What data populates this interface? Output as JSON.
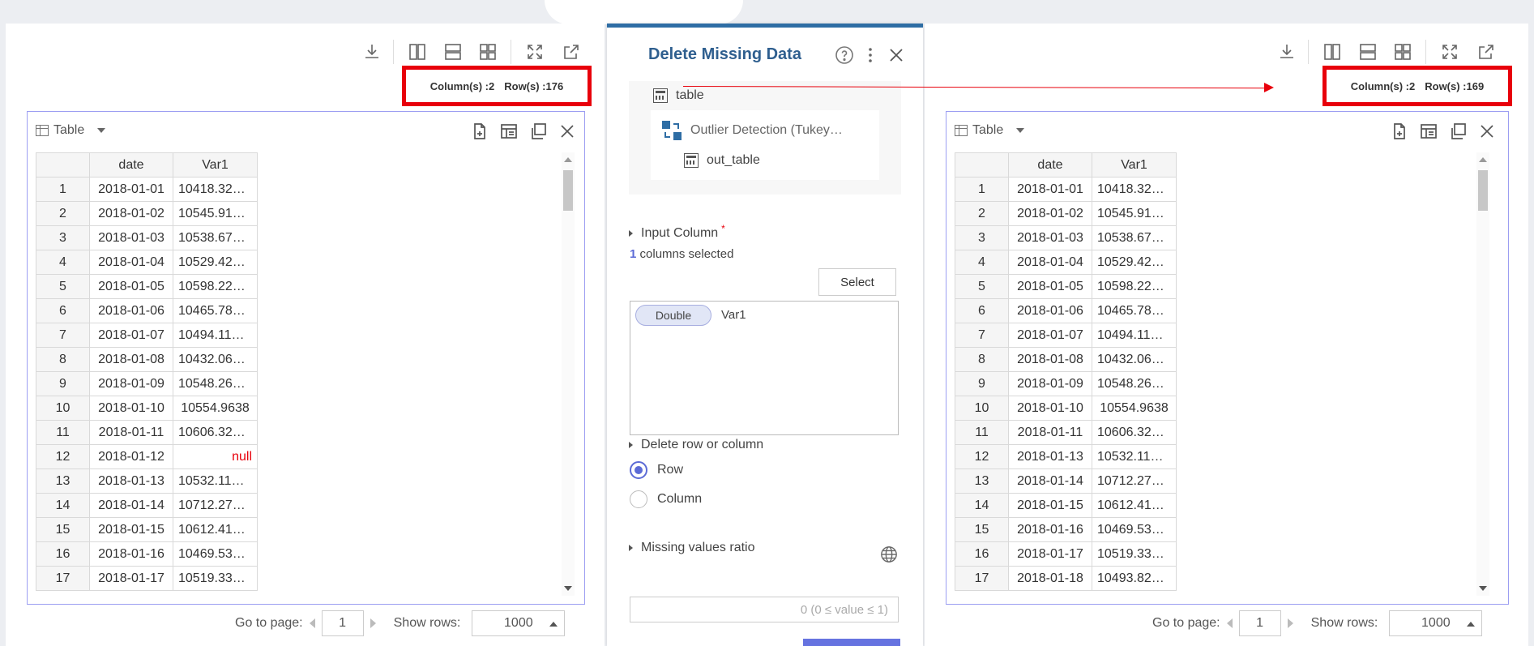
{
  "colors": {
    "accent": "#2e6da4",
    "highlight": "#e8000b",
    "radio": "#5c6bd6"
  },
  "left_panel": {
    "stats": {
      "columns": "Column(s) :2",
      "rows": "Row(s) :176"
    },
    "table_title": "Table",
    "columns": [
      "date",
      "Var1"
    ],
    "rows": [
      [
        "1",
        "2018-01-01",
        "10418.32..."
      ],
      [
        "2",
        "2018-01-02",
        "10545.91..."
      ],
      [
        "3",
        "2018-01-03",
        "10538.67..."
      ],
      [
        "4",
        "2018-01-04",
        "10529.42..."
      ],
      [
        "5",
        "2018-01-05",
        "10598.22..."
      ],
      [
        "6",
        "2018-01-06",
        "10465.78..."
      ],
      [
        "7",
        "2018-01-07",
        "10494.11..."
      ],
      [
        "8",
        "2018-01-08",
        "10432.06..."
      ],
      [
        "9",
        "2018-01-09",
        "10548.26..."
      ],
      [
        "10",
        "2018-01-10",
        "10554.9638"
      ],
      [
        "11",
        "2018-01-11",
        "10606.32..."
      ],
      [
        "12",
        "2018-01-12",
        "null"
      ],
      [
        "13",
        "2018-01-13",
        "10532.11..."
      ],
      [
        "14",
        "2018-01-14",
        "10712.27..."
      ],
      [
        "15",
        "2018-01-15",
        "10612.41..."
      ],
      [
        "16",
        "2018-01-16",
        "10469.53..."
      ],
      [
        "17",
        "2018-01-17",
        "10519.33..."
      ]
    ],
    "pager": {
      "goto_label": "Go to page:",
      "page": "1",
      "show_rows_label": "Show rows:",
      "show_rows": "1000"
    }
  },
  "right_panel": {
    "stats": {
      "columns": "Column(s) :2",
      "rows": "Row(s) :169"
    },
    "table_title": "Table",
    "columns": [
      "date",
      "Var1"
    ],
    "rows": [
      [
        "1",
        "2018-01-01",
        "10418.32..."
      ],
      [
        "2",
        "2018-01-02",
        "10545.91..."
      ],
      [
        "3",
        "2018-01-03",
        "10538.67..."
      ],
      [
        "4",
        "2018-01-04",
        "10529.42..."
      ],
      [
        "5",
        "2018-01-05",
        "10598.22..."
      ],
      [
        "6",
        "2018-01-06",
        "10465.78..."
      ],
      [
        "7",
        "2018-01-07",
        "10494.11..."
      ],
      [
        "8",
        "2018-01-08",
        "10432.06..."
      ],
      [
        "9",
        "2018-01-09",
        "10548.26..."
      ],
      [
        "10",
        "2018-01-10",
        "10554.9638"
      ],
      [
        "11",
        "2018-01-11",
        "10606.32..."
      ],
      [
        "12",
        "2018-01-13",
        "10532.11..."
      ],
      [
        "13",
        "2018-01-14",
        "10712.27..."
      ],
      [
        "14",
        "2018-01-15",
        "10612.41..."
      ],
      [
        "15",
        "2018-01-16",
        "10469.53..."
      ],
      [
        "16",
        "2018-01-17",
        "10519.33..."
      ],
      [
        "17",
        "2018-01-18",
        "10493.82..."
      ]
    ],
    "pager": {
      "goto_label": "Go to page:",
      "page": "1",
      "show_rows_label": "Show rows:",
      "show_rows": "1000"
    }
  },
  "dialog": {
    "title": "Delete Missing Data",
    "tree": {
      "table": "table",
      "node": "Outlier Detection (Tukey...",
      "out": "out_table"
    },
    "input_column": {
      "label": "Input Column",
      "required": "*",
      "count": "1",
      "count_suffix": "columns selected",
      "select_button": "Select",
      "chip_type": "Double",
      "chip_name": "Var1"
    },
    "delete_section": {
      "label": "Delete row or column",
      "options": [
        "Row",
        "Column"
      ],
      "selected": "Row"
    },
    "missing_ratio": {
      "label": "Missing values ratio",
      "placeholder": "0 (0 ≤ value ≤ 1)"
    }
  }
}
